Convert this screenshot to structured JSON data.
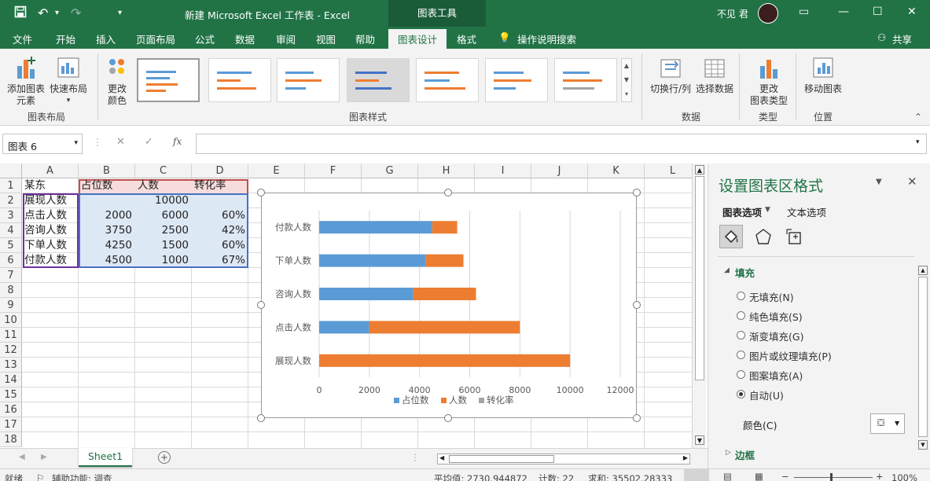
{
  "titlebar": {
    "title": "新建 Microsoft Excel 工作表  -  Excel",
    "context_tools": "图表工具",
    "user": "不见 君"
  },
  "tabs": [
    "文件",
    "开始",
    "插入",
    "页面布局",
    "公式",
    "数据",
    "审阅",
    "视图",
    "帮助",
    "图表设计",
    "格式"
  ],
  "active_tab": "图表设计",
  "tell_me": "操作说明搜索",
  "share": "共享",
  "ribbon": {
    "add_element": "添加图表\n元素",
    "quick_layout": "快速布局",
    "change_colors": "更改\n颜色",
    "group_layout": "图表布局",
    "group_styles": "图表样式",
    "switch_row_col": "切换行/列",
    "select_data": "选择数据",
    "group_data": "数据",
    "change_type": "更改\n图表类型",
    "group_type": "类型",
    "move_chart": "移动图表",
    "group_location": "位置"
  },
  "formula_bar": {
    "name_box": "图表 6",
    "fx": "fx",
    "content": ""
  },
  "columns": [
    "A",
    "B",
    "C",
    "D",
    "E",
    "F",
    "G",
    "H",
    "I",
    "J",
    "K",
    "L"
  ],
  "rows": [
    "1",
    "2",
    "3",
    "4",
    "5",
    "6",
    "7",
    "8",
    "9",
    "10",
    "11",
    "12",
    "13",
    "14",
    "15",
    "16",
    "17",
    "18"
  ],
  "table": [
    [
      "某东",
      "占位数",
      "人数",
      "转化率"
    ],
    [
      "展现人数",
      "",
      "10000",
      ""
    ],
    [
      "点击人数",
      "2000",
      "6000",
      "60%"
    ],
    [
      "咨询人数",
      "3750",
      "2500",
      "42%"
    ],
    [
      "下单人数",
      "4250",
      "1500",
      "60%"
    ],
    [
      "付款人数",
      "4500",
      "1000",
      "67%"
    ]
  ],
  "chart_data": {
    "type": "bar",
    "orientation": "horizontal",
    "stacked": true,
    "categories": [
      "展现人数",
      "点击人数",
      "咨询人数",
      "下单人数",
      "付款人数"
    ],
    "series": [
      {
        "name": "占位数",
        "values": [
          0,
          2000,
          3750,
          4250,
          4500
        ],
        "color": "#5b9bd5"
      },
      {
        "name": "人数",
        "values": [
          10000,
          6000,
          2500,
          1500,
          1000
        ],
        "color": "#ed7d31"
      },
      {
        "name": "转化率",
        "values": [
          0,
          0.6,
          0.42,
          0.6,
          0.67
        ],
        "color": "#a5a5a5"
      }
    ],
    "xlim": [
      0,
      12000
    ],
    "xticks": [
      "0",
      "2000",
      "4000",
      "6000",
      "8000",
      "10000",
      "12000"
    ],
    "legend": "bottom",
    "grid": true
  },
  "sheet_tab": "Sheet1",
  "status": {
    "ready": "就绪",
    "accessibility": "辅助功能: 调查",
    "average": "平均值: 2730.944872",
    "count": "计数: 22",
    "sum": "求和: 35502.28333",
    "zoom": "100%"
  },
  "pane": {
    "title": "设置图表区格式",
    "tab_chart_options": "图表选项",
    "tab_text_options": "文本选项",
    "section_fill": "填充",
    "fill_options": [
      "无填充(N)",
      "纯色填充(S)",
      "渐变填充(G)",
      "图片或纹理填充(P)",
      "图案填充(A)",
      "自动(U)"
    ],
    "selected_fill": 5,
    "color_label": "颜色(C)",
    "section_border": "边框"
  }
}
